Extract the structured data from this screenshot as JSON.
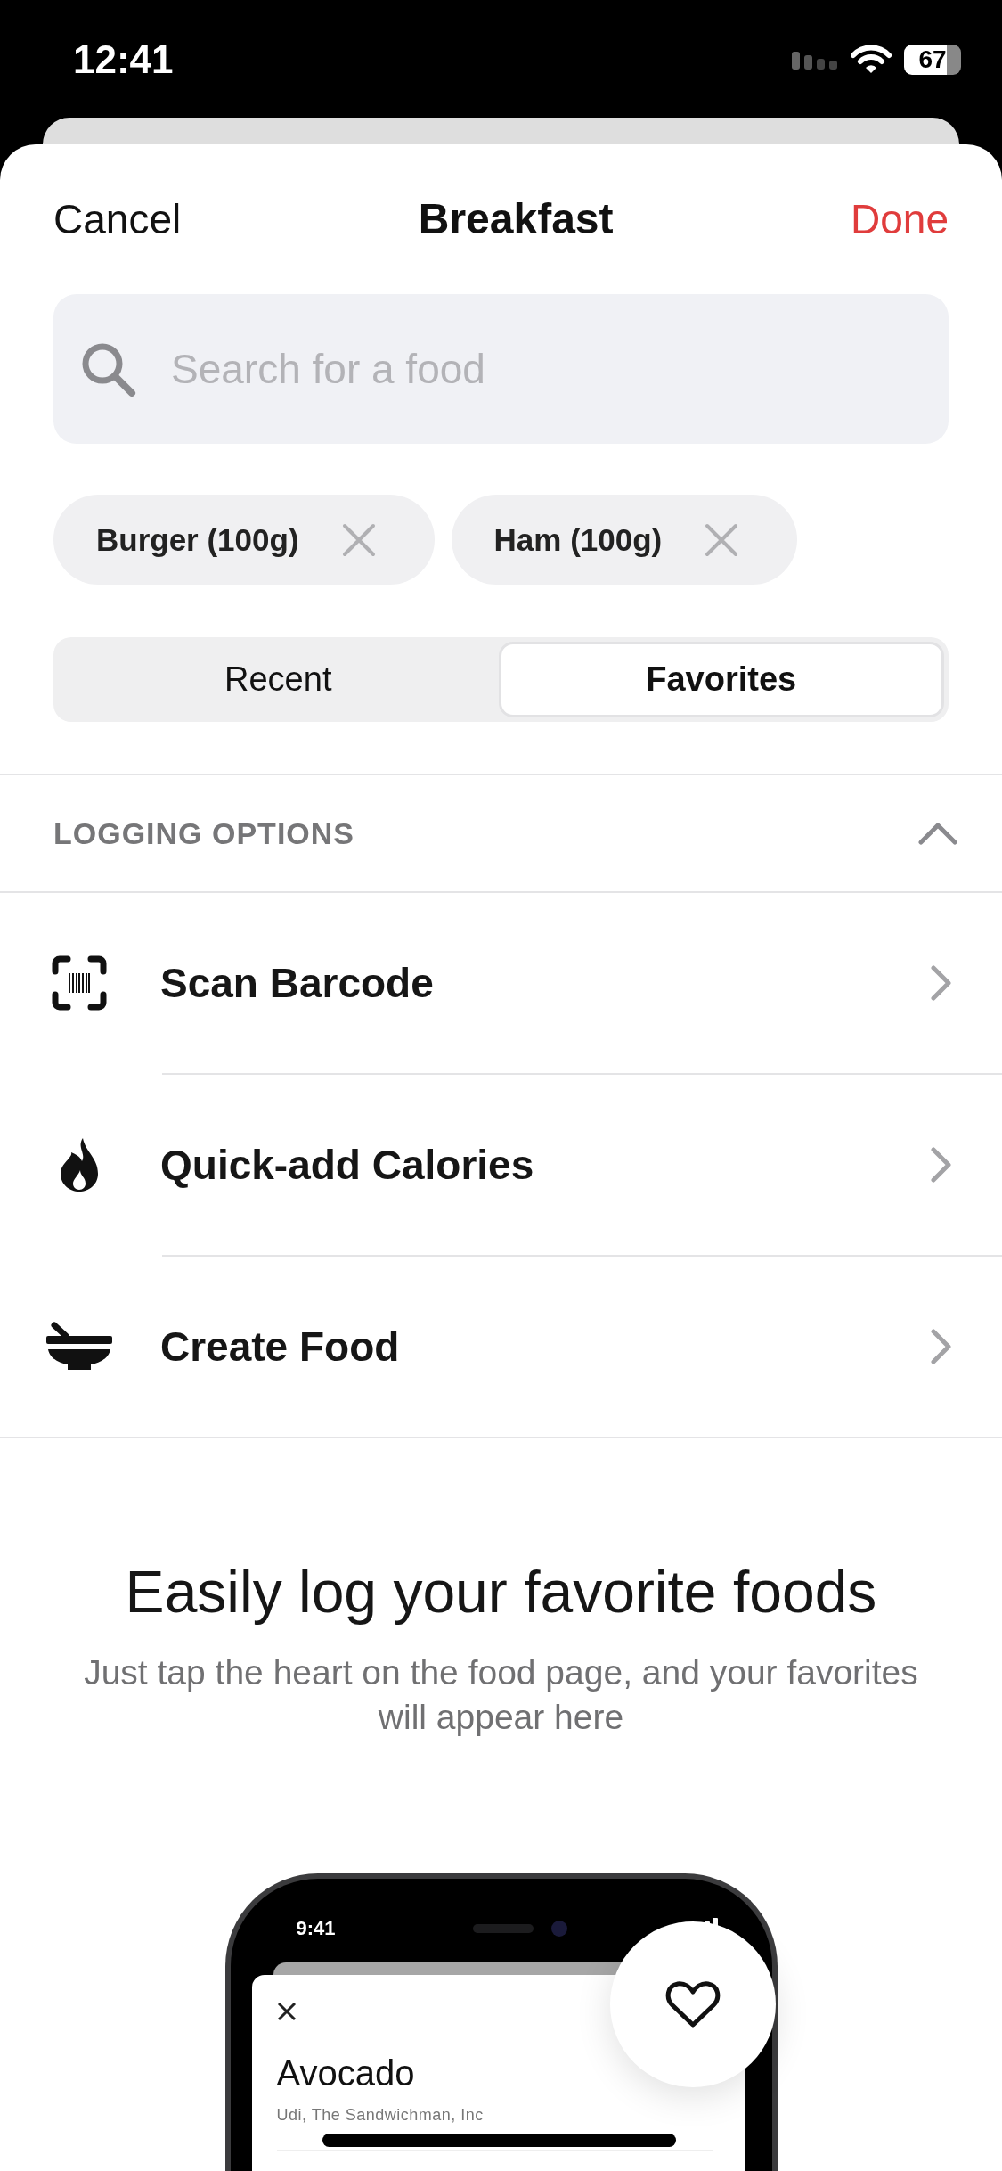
{
  "status_bar": {
    "time": "12:41",
    "battery": "67"
  },
  "header": {
    "cancel": "Cancel",
    "title": "Breakfast",
    "done": "Done"
  },
  "search": {
    "placeholder": "Search for a food"
  },
  "chips": [
    {
      "label": "Burger (100g)"
    },
    {
      "label": "Ham (100g)"
    }
  ],
  "segments": [
    {
      "label": "Recent",
      "selected": false
    },
    {
      "label": "Favorites",
      "selected": true
    }
  ],
  "logging_options": {
    "title": "LOGGING OPTIONS",
    "expanded": true,
    "items": [
      {
        "kind": "barcode",
        "label": "Scan Barcode"
      },
      {
        "kind": "calories",
        "label": "Quick-add Calories"
      },
      {
        "kind": "food",
        "label": "Create Food"
      }
    ]
  },
  "empty_state": {
    "title": "Easily log your favorite foods",
    "message": "Just tap the heart on the food page, and your favorites will appear here"
  },
  "illustration": {
    "time": "9:41",
    "food_name": "Avocado",
    "brand": "Udi, The Sandwichman, Inc",
    "favorited": false
  }
}
